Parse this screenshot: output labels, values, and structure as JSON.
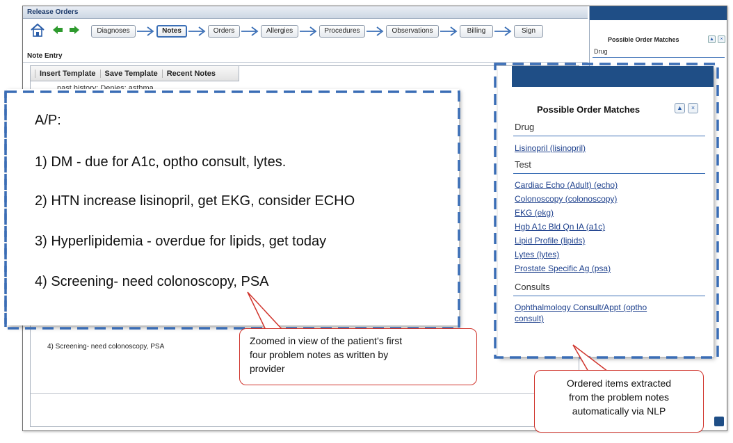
{
  "app": {
    "title": "Release Orders",
    "note_entry_label": "Note Entry",
    "workflow_steps": [
      "Diagnoses",
      "Notes",
      "Orders",
      "Allergies",
      "Procedures",
      "Observations",
      "Billing",
      "Sign"
    ],
    "active_step": "Notes",
    "toolbar": {
      "insert_template": "Insert Template",
      "save_template": "Save Template",
      "recent_notes": "Recent Notes"
    },
    "editor_partial_line": "past history: Denies: asthma",
    "editor_line4": "4) Screening- need colonoscopy, PSA",
    "right_panel": {
      "title": "Possible Order Matches",
      "first_section": "Drug"
    }
  },
  "zoom_notes": {
    "heading": "A/P:",
    "items": [
      "1) DM - due for A1c, optho consult, lytes.",
      "2) HTN increase lisinopril, get EKG, consider ECHO",
      "3) Hyperlipidemia - overdue for lipids, get today",
      "4) Screening- need colonoscopy, PSA"
    ]
  },
  "zoom_orders": {
    "title": "Possible Order Matches",
    "sections": [
      {
        "name": "Drug",
        "items": [
          "Lisinopril (lisinopril)"
        ]
      },
      {
        "name": "Test",
        "items": [
          "Cardiac Echo (Adult) (echo)",
          "Colonoscopy (colonoscopy)",
          "EKG (ekg)",
          "Hgb A1c Bld Qn IA (a1c)",
          "Lipid Profile (lipids)",
          "Lytes (lytes)",
          "Prostate Specific Ag (psa)"
        ]
      },
      {
        "name": "Consults",
        "items": [
          "Ophthalmology Consult/Appt (optho",
          "consult)"
        ]
      }
    ]
  },
  "callouts": {
    "left": [
      "Zoomed in view of the patient’s first",
      "four problem notes as written by",
      "provider"
    ],
    "right": [
      "Ordered items extracted",
      "from the problem notes",
      "automatically via NLP"
    ]
  },
  "colors": {
    "header_blue": "#1f4e86",
    "dash_blue": "#3a6db5",
    "link_blue": "#1c3f8c",
    "callout_red": "#d0342c",
    "nav_green": "#2e9a2e"
  },
  "icons": [
    "home-icon",
    "back-arrow-icon",
    "forward-arrow-icon",
    "step-arrow-icon",
    "collapse-icon",
    "close-icon"
  ]
}
